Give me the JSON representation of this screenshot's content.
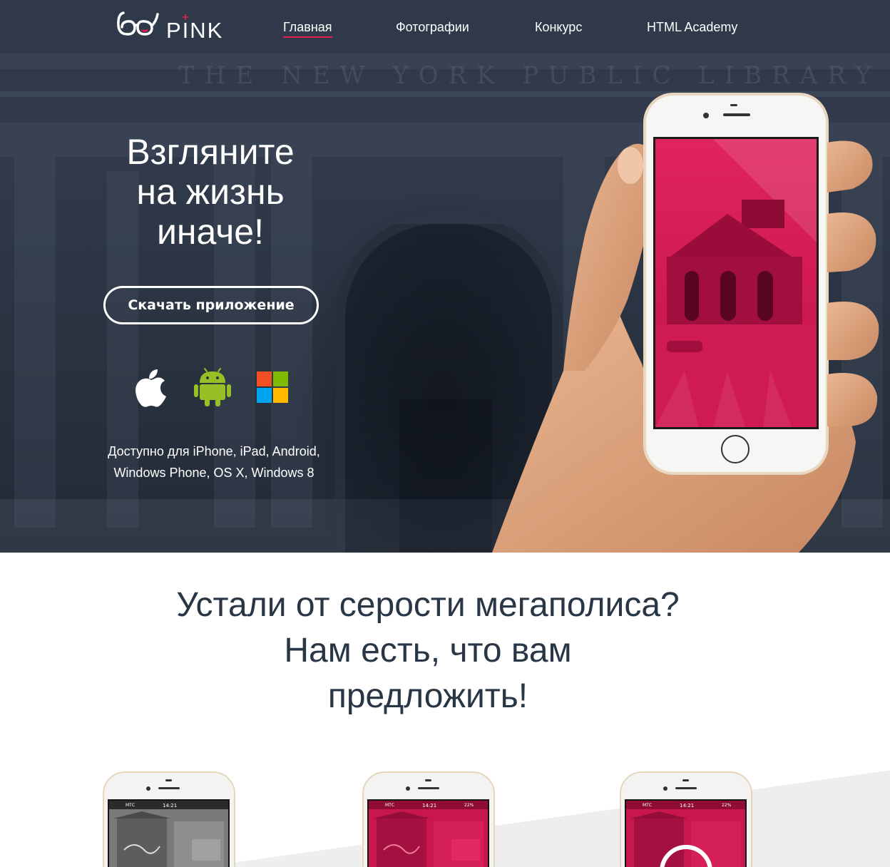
{
  "brand": {
    "name": "PINK"
  },
  "nav": {
    "items": [
      {
        "label": "Главная",
        "active": true
      },
      {
        "label": "Фотографии",
        "active": false
      },
      {
        "label": "Конкурс",
        "active": false
      },
      {
        "label": "HTML Academy",
        "active": false
      }
    ]
  },
  "hero": {
    "background_text": "THE NEW YORK PUBLIC LIBRARY",
    "title_lines": [
      "Взгляните",
      "на жизнь",
      "иначе!"
    ],
    "download_button": "Скачать приложение",
    "platform_icons": [
      "apple-icon",
      "android-icon",
      "windows-icon"
    ],
    "availability_lines": [
      "Доступно для iPhone, iPad, Android,",
      "Windows Phone, OS X, Windows 8"
    ]
  },
  "features": {
    "title_lines": [
      "Устали от серости мегаполиса?",
      "Нам есть, что вам",
      "предложить!"
    ],
    "phones": [
      {
        "carrier": "МТС",
        "time": "14:21",
        "battery": "",
        "theme": "grayscale"
      },
      {
        "carrier": "МТС",
        "time": "14:21",
        "battery": "22%",
        "theme": "pink"
      },
      {
        "carrier": "МТС",
        "time": "14:21",
        "battery": "22%",
        "theme": "pink"
      }
    ]
  },
  "colors": {
    "accent": "#e71d53",
    "hero_bg": "#2f3949",
    "text_dark": "#283645",
    "white": "#ffffff"
  }
}
